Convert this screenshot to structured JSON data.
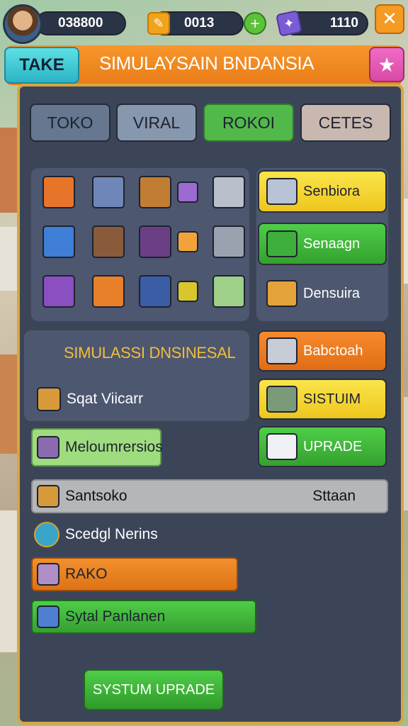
{
  "hud": {
    "coins": "038800",
    "energy": "0013",
    "gems": "1110",
    "energy_icon": "pencil-icon",
    "add_icon": "plus-icon",
    "gift_icon": "gift-icon",
    "close_glyph": "✕"
  },
  "header": {
    "take_label": "TAKE",
    "title": "SIMULAYSAIN BNDANSIA",
    "star_glyph": "★"
  },
  "tabs": [
    {
      "label": "TOKO"
    },
    {
      "label": "VIRAL"
    },
    {
      "label": "ROKOI"
    },
    {
      "label": "CETES"
    }
  ],
  "items": [
    {
      "icon": "store-orange-icon",
      "color": "#e8742a"
    },
    {
      "icon": "cash-register-icon",
      "color": "#6f86b8"
    },
    {
      "icon": "shelf-icon",
      "color": "#c27d34"
    },
    {
      "icon": "box-purple-icon",
      "color": "#9b6bd1"
    },
    {
      "icon": "cart-icon",
      "color": "#b9c0cc"
    },
    {
      "icon": "store-blue-icon",
      "color": "#3f7fd8"
    },
    {
      "icon": "fridge-icon",
      "color": "#8a5b3a"
    },
    {
      "icon": "cabinet-icon",
      "color": "#6b3f86"
    },
    {
      "icon": "box-orange-icon",
      "color": "#f0a33a"
    },
    {
      "icon": "counter-icon",
      "color": "#9aa2b0"
    },
    {
      "icon": "store-purple-icon",
      "color": "#8a4fc0"
    },
    {
      "icon": "stall-icon",
      "color": "#e8802a"
    },
    {
      "icon": "locker-icon",
      "color": "#3b5da6"
    },
    {
      "icon": "basket-icon",
      "color": "#d7c62f"
    },
    {
      "icon": "cart-green-icon",
      "color": "#9fd08a"
    }
  ],
  "side_buttons": [
    {
      "label": "Senbiora",
      "icon": "truck-icon"
    },
    {
      "label": "Senaagn",
      "icon": "crate-green-icon"
    },
    {
      "label": "Densuira",
      "icon": "cabinet-orange-icon"
    }
  ],
  "sim_section": {
    "title": "SIMULASSI DNSINESAL",
    "row_label": "Sqat Viicarr"
  },
  "action_buttons": [
    {
      "label": "Babctoah",
      "icon": "house-icon"
    },
    {
      "label": "SISTUIM",
      "icon": "box-green-icon"
    },
    {
      "label": "UPRADE",
      "icon": "table-icon"
    }
  ],
  "bars": {
    "meloun": "Meloumrersios",
    "santsoko": "Santsoko",
    "santsoko_status": "Sttaan",
    "scedgl": "Scedgl Nerins",
    "rako": "RAKO",
    "sytal": "Sytal Panlanen"
  },
  "footer": {
    "update_label": "SYSTUM UPRADE"
  }
}
